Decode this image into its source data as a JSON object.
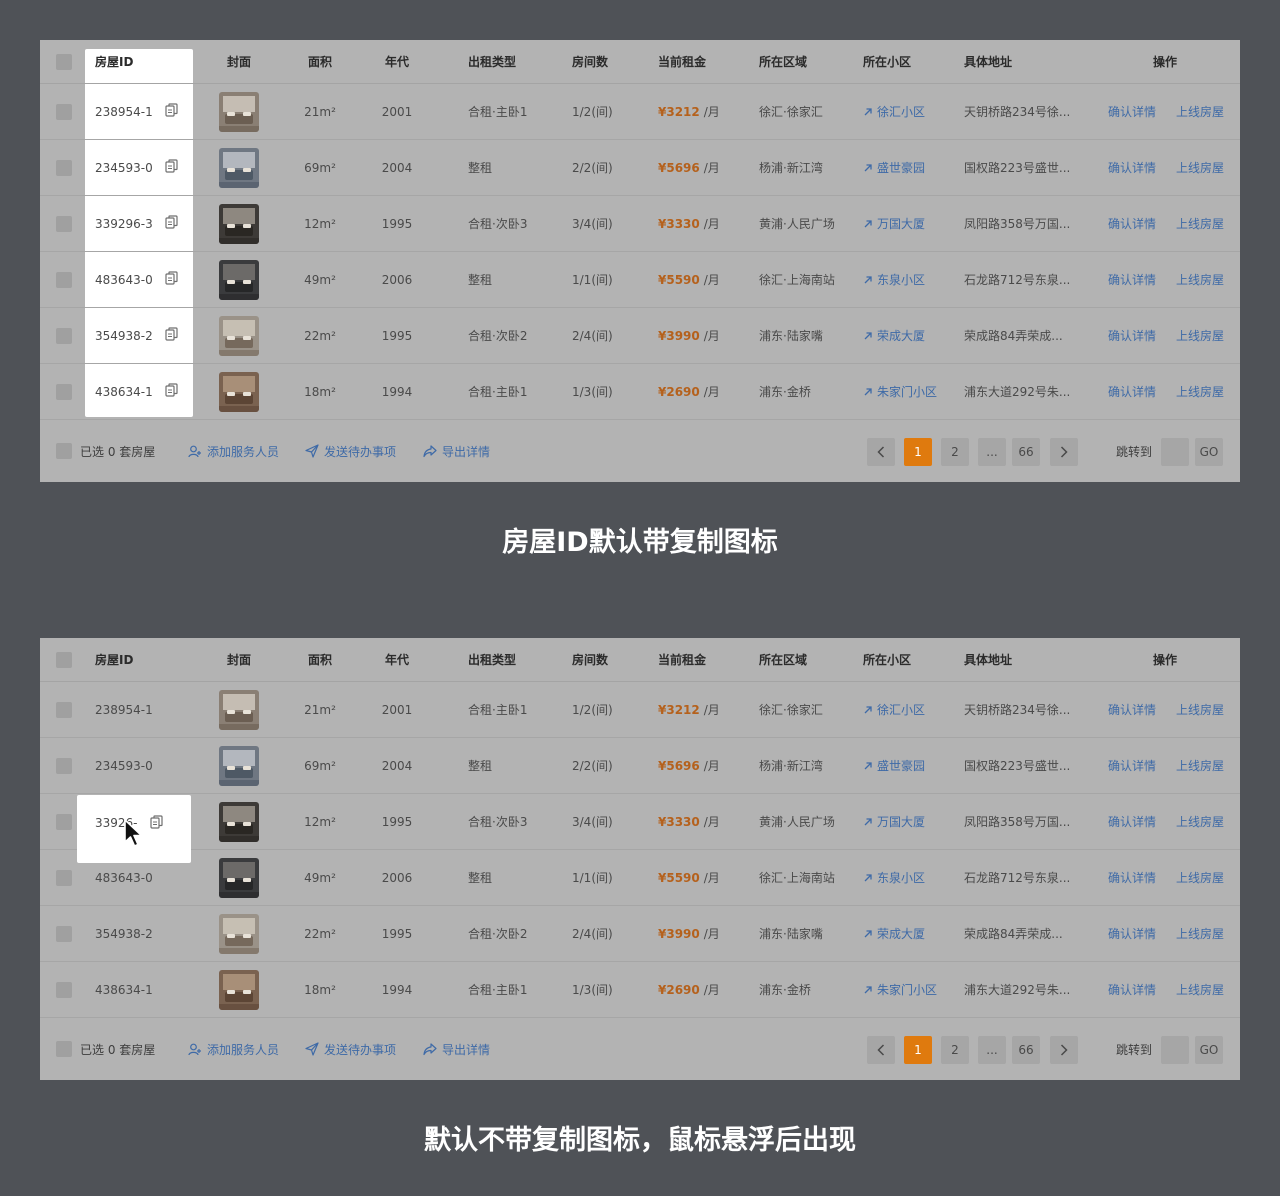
{
  "headers": {
    "house_id": "房屋ID",
    "cover": "封面",
    "area": "面积",
    "year": "年代",
    "rent_type": "出租类型",
    "rooms": "房间数",
    "rent": "当前租金",
    "region": "所在区域",
    "community": "所在小区",
    "address": "具体地址",
    "ops": "操作"
  },
  "rows": [
    {
      "id": "238954-1",
      "area": "21m²",
      "year": "2001",
      "rent_type": "合租·主卧1",
      "rooms": "1/2(间)",
      "rent": "¥3212",
      "unit": "/月",
      "region": "徐汇·徐家汇",
      "community": "徐汇小区",
      "address": "天钥桥路234号徐...",
      "op1": "确认详情",
      "op2": "上线房屋"
    },
    {
      "id": "234593-0",
      "area": "69m²",
      "year": "2004",
      "rent_type": "整租",
      "rooms": "2/2(间)",
      "rent": "¥5696",
      "unit": "/月",
      "region": "杨浦·新江湾",
      "community": "盛世豪园",
      "address": "国权路223号盛世...",
      "op1": "确认详情",
      "op2": "上线房屋"
    },
    {
      "id": "339296-3",
      "area": "12m²",
      "year": "1995",
      "rent_type": "合租·次卧3",
      "rooms": "3/4(间)",
      "rent": "¥3330",
      "unit": "/月",
      "region": "黄浦·人民广场",
      "community": "万国大厦",
      "address": "凤阳路358号万国...",
      "op1": "确认详情",
      "op2": "上线房屋"
    },
    {
      "id": "483643-0",
      "area": "49m²",
      "year": "2006",
      "rent_type": "整租",
      "rooms": "1/1(间)",
      "rent": "¥5590",
      "unit": "/月",
      "region": "徐汇·上海南站",
      "community": "东泉小区",
      "address": "石龙路712号东泉...",
      "op1": "确认详情",
      "op2": "上线房屋"
    },
    {
      "id": "354938-2",
      "area": "22m²",
      "year": "1995",
      "rent_type": "合租·次卧2",
      "rooms": "2/4(间)",
      "rent": "¥3990",
      "unit": "/月",
      "region": "浦东·陆家嘴",
      "community": "荣成大厦",
      "address": "荣成路84弄荣成...",
      "op1": "确认详情",
      "op2": "上线房屋"
    },
    {
      "id": "438634-1",
      "area": "18m²",
      "year": "1994",
      "rent_type": "合租·主卧1",
      "rooms": "1/3(间)",
      "rent": "¥2690",
      "unit": "/月",
      "region": "浦东·金桥",
      "community": "朱家门小区",
      "address": "浦东大道292号朱...",
      "op1": "确认详情",
      "op2": "上线房屋"
    }
  ],
  "hover_row_id_partial": "3392",
  "hover_row_id_tail": "6-",
  "footer": {
    "selected": "已选 0 套房屋",
    "add_staff": "添加服务人员",
    "send_todo": "发送待办事项",
    "export": "导出详情",
    "pages": [
      "1",
      "2",
      "...",
      "66"
    ],
    "jump_label": "跳转到",
    "go": "GO"
  },
  "captions": {
    "top": "房屋ID默认带复制图标",
    "bottom": "默认不带复制图标，鼠标悬浮后出现"
  },
  "colors": {
    "rent": "#b5611c",
    "link": "#3e6aa7",
    "active_page": "#df7a0e",
    "background": "#4f5257"
  },
  "icons": {
    "copy": "copy-icon",
    "link_arrow": "arrow-up-right-icon",
    "add_user": "add-user-icon",
    "send": "send-icon",
    "export": "share-icon",
    "prev": "chevron-left-icon",
    "next": "chevron-right-icon",
    "cursor": "mouse-cursor-icon"
  }
}
